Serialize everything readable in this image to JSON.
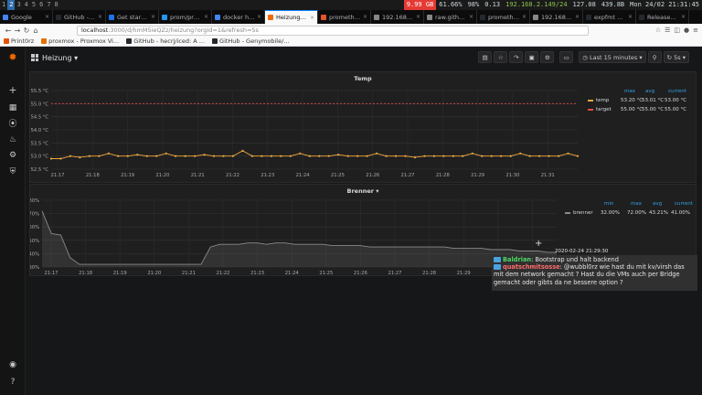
{
  "statusbar": {
    "workspaces": [
      "1",
      "2",
      "3",
      "4",
      "5",
      "6",
      "7",
      "8"
    ],
    "active_workspace": 1,
    "disk": "9.99 GB",
    "cpu": "61.66%",
    "battery": "98%",
    "load": "0.13",
    "ip": "192.168.2.149/24",
    "ram": "127.08",
    "swap": "439.8B",
    "datetime": "Mon 24/02 21:31:45"
  },
  "tabs": [
    {
      "title": "Google",
      "color": "#4285f4"
    },
    {
      "title": "GitHub - opi",
      "color": "#24292e"
    },
    {
      "title": "Get started",
      "color": "#1a73e8"
    },
    {
      "title": "prom/prom",
      "color": "#2496ed"
    },
    {
      "title": "docker hub",
      "color": "#4285f4"
    },
    {
      "title": "Heizung - Gr",
      "color": "#f46800",
      "active": true
    },
    {
      "title": "prometheus",
      "color": "#e6522c"
    },
    {
      "title": "192.168.2.149",
      "color": "#888888"
    },
    {
      "title": "raw.githubuser",
      "color": "#888888"
    },
    {
      "title": "prometheus",
      "color": "#24292e"
    },
    {
      "title": "192.168.2.149",
      "color": "#888888"
    },
    {
      "title": "expfmt show",
      "color": "#24292e"
    },
    {
      "title": "Releases - p",
      "color": "#24292e"
    }
  ],
  "nav": {
    "url_host": "localhost",
    "url_path": ":3000/d/hmM5ieQZz/heizung?orgId=1&refresh=5s"
  },
  "bookmarks": [
    {
      "label": "Print0rz",
      "color": "#e65100"
    },
    {
      "label": "proxmox - Proxmox Vi...",
      "color": "#e57000"
    },
    {
      "label": "GitHub - hecrj/iced: A ...",
      "color": "#24292e"
    },
    {
      "label": "GitHub - Genymobile/...",
      "color": "#24292e"
    }
  ],
  "dashboard": {
    "title": "Heizung",
    "time_range": "Last 15 minutes",
    "refresh": "5s"
  },
  "panel_temp": {
    "title": "Temp",
    "legend_headers": [
      "max",
      "avg",
      "current"
    ],
    "legend": [
      {
        "name": "temp",
        "color": "#f2a93a",
        "max": "53.20 °C",
        "avg": "53.01 °C",
        "current": "53.00 °C"
      },
      {
        "name": "target",
        "color": "#e24d42",
        "max": "55.00 °C",
        "avg": "55.00 °C",
        "current": "55.00 °C"
      }
    ]
  },
  "panel_brenner": {
    "title": "Brenner",
    "legend_headers": [
      "min",
      "max",
      "avg",
      "current"
    ],
    "legend": [
      {
        "name": "brenner",
        "color": "#8a8a8a",
        "min": "32.00%",
        "max": "72.00%",
        "avg": "43.21%",
        "current": "41.00%"
      }
    ]
  },
  "chart_data": [
    {
      "type": "line",
      "title": "Temp",
      "x": [
        "21:17",
        "21:18",
        "21:19",
        "21:20",
        "21:21",
        "21:22",
        "21:23",
        "21:24",
        "21:25",
        "21:26",
        "21:27",
        "21:28",
        "21:29",
        "21:30",
        "21:31"
      ],
      "yticks": [
        "52.5 °C",
        "53.0 °C",
        "53.5 °C",
        "54.0 °C",
        "54.5 °C",
        "55.0 °C",
        "55.5 °C"
      ],
      "ylim": [
        52.5,
        55.5
      ],
      "series": [
        {
          "name": "temp",
          "color": "#f2a93a",
          "values": [
            52.9,
            52.9,
            53.0,
            52.95,
            53.0,
            53.0,
            53.1,
            53.0,
            53.0,
            53.05,
            53.0,
            53.0,
            53.1,
            53.0,
            53.0,
            53.0,
            53.05,
            53.0,
            53.0,
            53.0,
            53.2,
            53.0,
            53.0,
            53.0,
            53.0,
            53.0,
            53.1,
            53.0,
            53.0,
            53.0,
            53.05,
            53.0,
            53.0,
            53.0,
            53.1,
            53.0,
            53.0,
            53.0,
            52.95,
            53.0,
            53.0,
            53.0,
            53.0,
            53.0,
            53.1,
            53.0,
            53.0,
            53.0,
            53.0,
            53.1,
            53.0,
            53.0,
            53.0,
            53.0,
            53.1,
            53.0
          ]
        },
        {
          "name": "target",
          "color": "#e24d42",
          "values": [
            55.0,
            55.0
          ]
        }
      ]
    },
    {
      "type": "area",
      "title": "Brenner",
      "x": [
        "21:17",
        "21:18",
        "21:19",
        "21:20",
        "21:21",
        "21:22",
        "21:23",
        "21:24",
        "21:25",
        "21:26",
        "21:27",
        "21:28",
        "21:29",
        "21:30",
        "21:31"
      ],
      "yticks": [
        "30%",
        "40%",
        "50%",
        "60%",
        "70%",
        "80%"
      ],
      "ylim": [
        30,
        80
      ],
      "series": [
        {
          "name": "brenner",
          "color": "#8a8a8a",
          "values": [
            72,
            55,
            54,
            37,
            32,
            32,
            32,
            32,
            32,
            32,
            32,
            32,
            32,
            32,
            32,
            32,
            32,
            32,
            45,
            47,
            47,
            47,
            48,
            48,
            47,
            48,
            48,
            47,
            47,
            47,
            47,
            46,
            46,
            46,
            46,
            45,
            45,
            45,
            45,
            45,
            45,
            45,
            45,
            45,
            44,
            44,
            44,
            44,
            43,
            43,
            43,
            42,
            42,
            42,
            41,
            41
          ]
        }
      ]
    }
  ],
  "tooltip": {
    "time": "2020-02-24 21:29:30"
  },
  "chat": {
    "line1_nick": "Baldrian",
    "line1_text": ": Bootstrap und halt backend",
    "line2_nick": "quatschmitsosse",
    "line2_text": ": @wubbl0rz wie hast du mit kv/virsh das mit dem network gemacht ? Hast du die VMs auch per Bridge gemacht oder gibts da ne bessere option ?"
  }
}
